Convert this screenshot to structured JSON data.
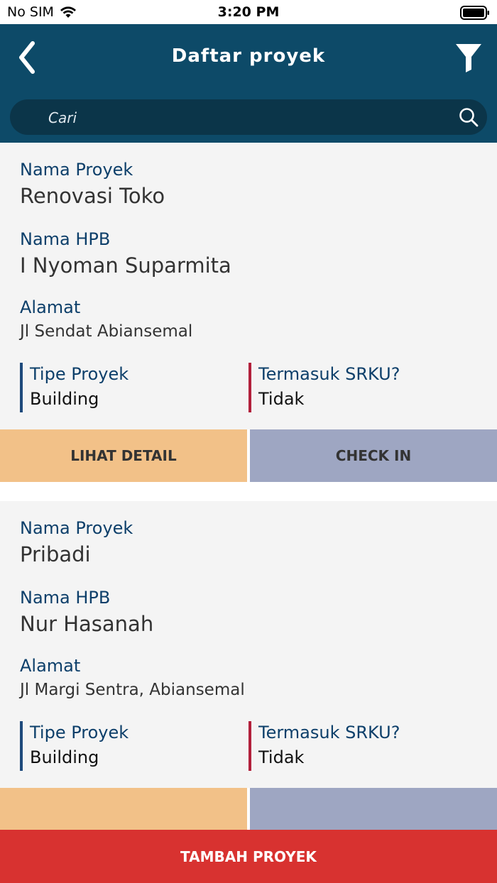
{
  "status_bar": {
    "carrier": "No SIM",
    "time": "3:20 PM"
  },
  "header": {
    "title": "Daftar proyek",
    "back_icon": "chevron-left-icon",
    "filter_icon": "filter-icon"
  },
  "search": {
    "placeholder": "Cari",
    "value": ""
  },
  "labels": {
    "project_name": "Nama Proyek",
    "hpb_name": "Nama HPB",
    "address": "Alamat",
    "project_type": "Tipe Proyek",
    "srku": "Termasuk SRKU?"
  },
  "projects": [
    {
      "name": "Renovasi Toko",
      "hpb": "I Nyoman Suparmita",
      "address": "Jl Sendat Abiansemal",
      "type": "Building",
      "srku": "Tidak"
    },
    {
      "name": "Pribadi",
      "hpb": "Nur Hasanah",
      "address": "Jl Margi Sentra, Abiansemal",
      "type": "Building",
      "srku": "Tidak"
    }
  ],
  "buttons": {
    "detail": "LIHAT DETAIL",
    "checkin": "CHECK IN",
    "add_project": "TAMBAH PROYEK"
  },
  "colors": {
    "header_bg": "#0d4a68",
    "search_bg": "#0b3549",
    "label_blue": "#0d3f6a",
    "detail_btn": "#f2c188",
    "checkin_btn": "#9ea6c2",
    "add_btn": "#d83230",
    "border_blue": "#1e4a7c",
    "border_red": "#b2203b"
  }
}
